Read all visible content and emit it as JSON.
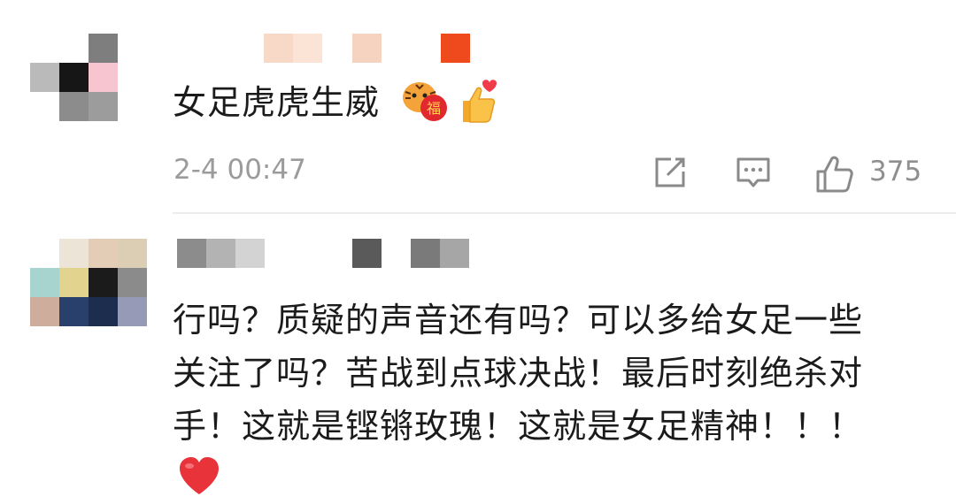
{
  "comments": [
    {
      "text": "女足虎虎生威",
      "emoji": [
        "tiger-fu-emoji",
        "thumbs-up-heart-emoji"
      ],
      "timestamp": "2-4 00:47",
      "actions": {
        "share_icon": "edit-share-icon",
        "reply_icon": "comment-icon",
        "like_icon": "thumbs-up-icon",
        "like_count": "375"
      }
    },
    {
      "lines": [
        "行吗？质疑的声音还有吗？可以多给女足一些",
        "关注了吗？苦战到点球决战！最后时刻绝杀对",
        "手！这就是铿锵玫瑰！这就是女足精神！！！"
      ],
      "emoji": [
        "red-heart-emoji"
      ]
    }
  ],
  "colors": {
    "text": "#1b1b1b",
    "meta": "#9b9b9b",
    "divider": "#ececec",
    "heart": "#e8333a"
  }
}
